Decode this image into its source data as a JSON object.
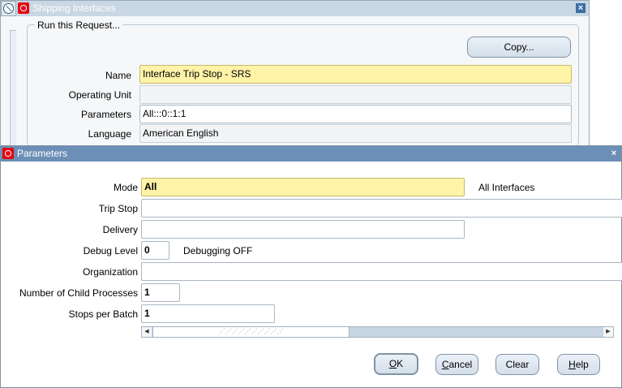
{
  "shipping_window": {
    "title": "Shipping Interfaces",
    "close_glyph": "×",
    "group_title": "Run this Request...",
    "copy_button": "Copy...",
    "fields": {
      "name_label": "Name",
      "name_value": "Interface Trip Stop - SRS",
      "operating_unit_label": "Operating Unit",
      "operating_unit_value": "",
      "parameters_label": "Parameters",
      "parameters_value": "All:::0::1:1",
      "language_label": "Language",
      "language_value": "American English"
    }
  },
  "parameters_window": {
    "title": "Parameters",
    "close_glyph": "×",
    "mode_label": "Mode",
    "mode_value": "All",
    "mode_description": "All Interfaces",
    "trip_stop_label": "Trip Stop",
    "trip_stop_value": "",
    "delivery_label": "Delivery",
    "delivery_value": "",
    "debug_level_label": "Debug Level",
    "debug_level_value": "0",
    "debug_level_description": "Debugging OFF",
    "organization_label": "Organization",
    "organization_value": "",
    "child_processes_label": "Number of Child Processes",
    "child_processes_value": "1",
    "stops_per_batch_label": "Stops per Batch",
    "stops_per_batch_value": "1",
    "scroll_left_glyph": "◀",
    "scroll_right_glyph": "▶",
    "scroll_grip": "⋰⋰⋰⋰⋰⋰⋰⋰⋰⋰",
    "buttons": {
      "ok_mnemonic": "O",
      "ok_rest": "K",
      "cancel_mnemonic": "C",
      "cancel_rest": "ancel",
      "clear": "Clear",
      "help_mnemonic": "H",
      "help_rest": "elp"
    }
  },
  "colors": {
    "titlebar_inactive": "#c9d6e3",
    "titlebar_active": "#6b8fb6",
    "required_field": "#fff3a8",
    "oracle_red": "#e30613"
  },
  "icons": [
    "navigator-icon",
    "oracle-logo-icon",
    "close-icon"
  ]
}
